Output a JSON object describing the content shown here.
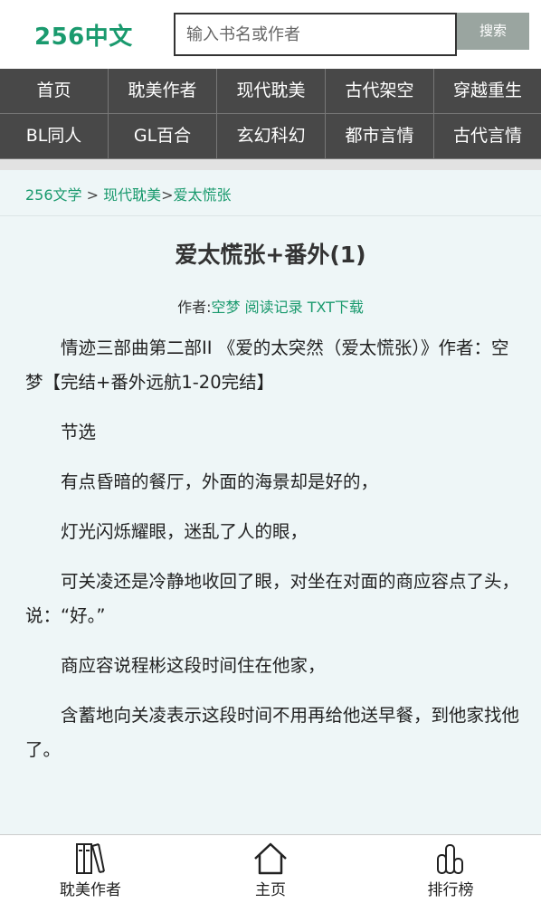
{
  "header": {
    "logo": "256中文",
    "search_placeholder": "输入书名或作者",
    "search_button": "搜索"
  },
  "nav": [
    "首页",
    "耽美作者",
    "现代耽美",
    "古代架空",
    "穿越重生",
    "BL同人",
    "GL百合",
    "玄幻科幻",
    "都市言情",
    "古代言情"
  ],
  "breadcrumb": {
    "home": "256文学",
    "separator": " > ",
    "category": "现代耽美",
    "separator2": ">",
    "current": "爱太慌张"
  },
  "article": {
    "title": "爱太慌张+番外(1)",
    "author_label": "作者:",
    "author": "空梦",
    "reading_record": "阅读记录",
    "txt_download": "TXT下载",
    "paragraphs": [
      "情迹三部曲第二部II 《爱的太突然（爱太慌张）》作者：空梦【完结+番外远航1-20完结】",
      "节选",
      "有点昏暗的餐厅，外面的海景却是好的，",
      "灯光闪烁耀眼，迷乱了人的眼，",
      "可关凌还是冷静地收回了眼，对坐在对面的商应容点了头，说：“好。”",
      "商应容说程彬这段时间住在他家，",
      "含蓄地向关凌表示这段时间不用再给他送早餐，到他家找他了。"
    ]
  },
  "bottom_nav": {
    "authors": "耽美作者",
    "home": "主页",
    "ranking": "排行榜"
  }
}
